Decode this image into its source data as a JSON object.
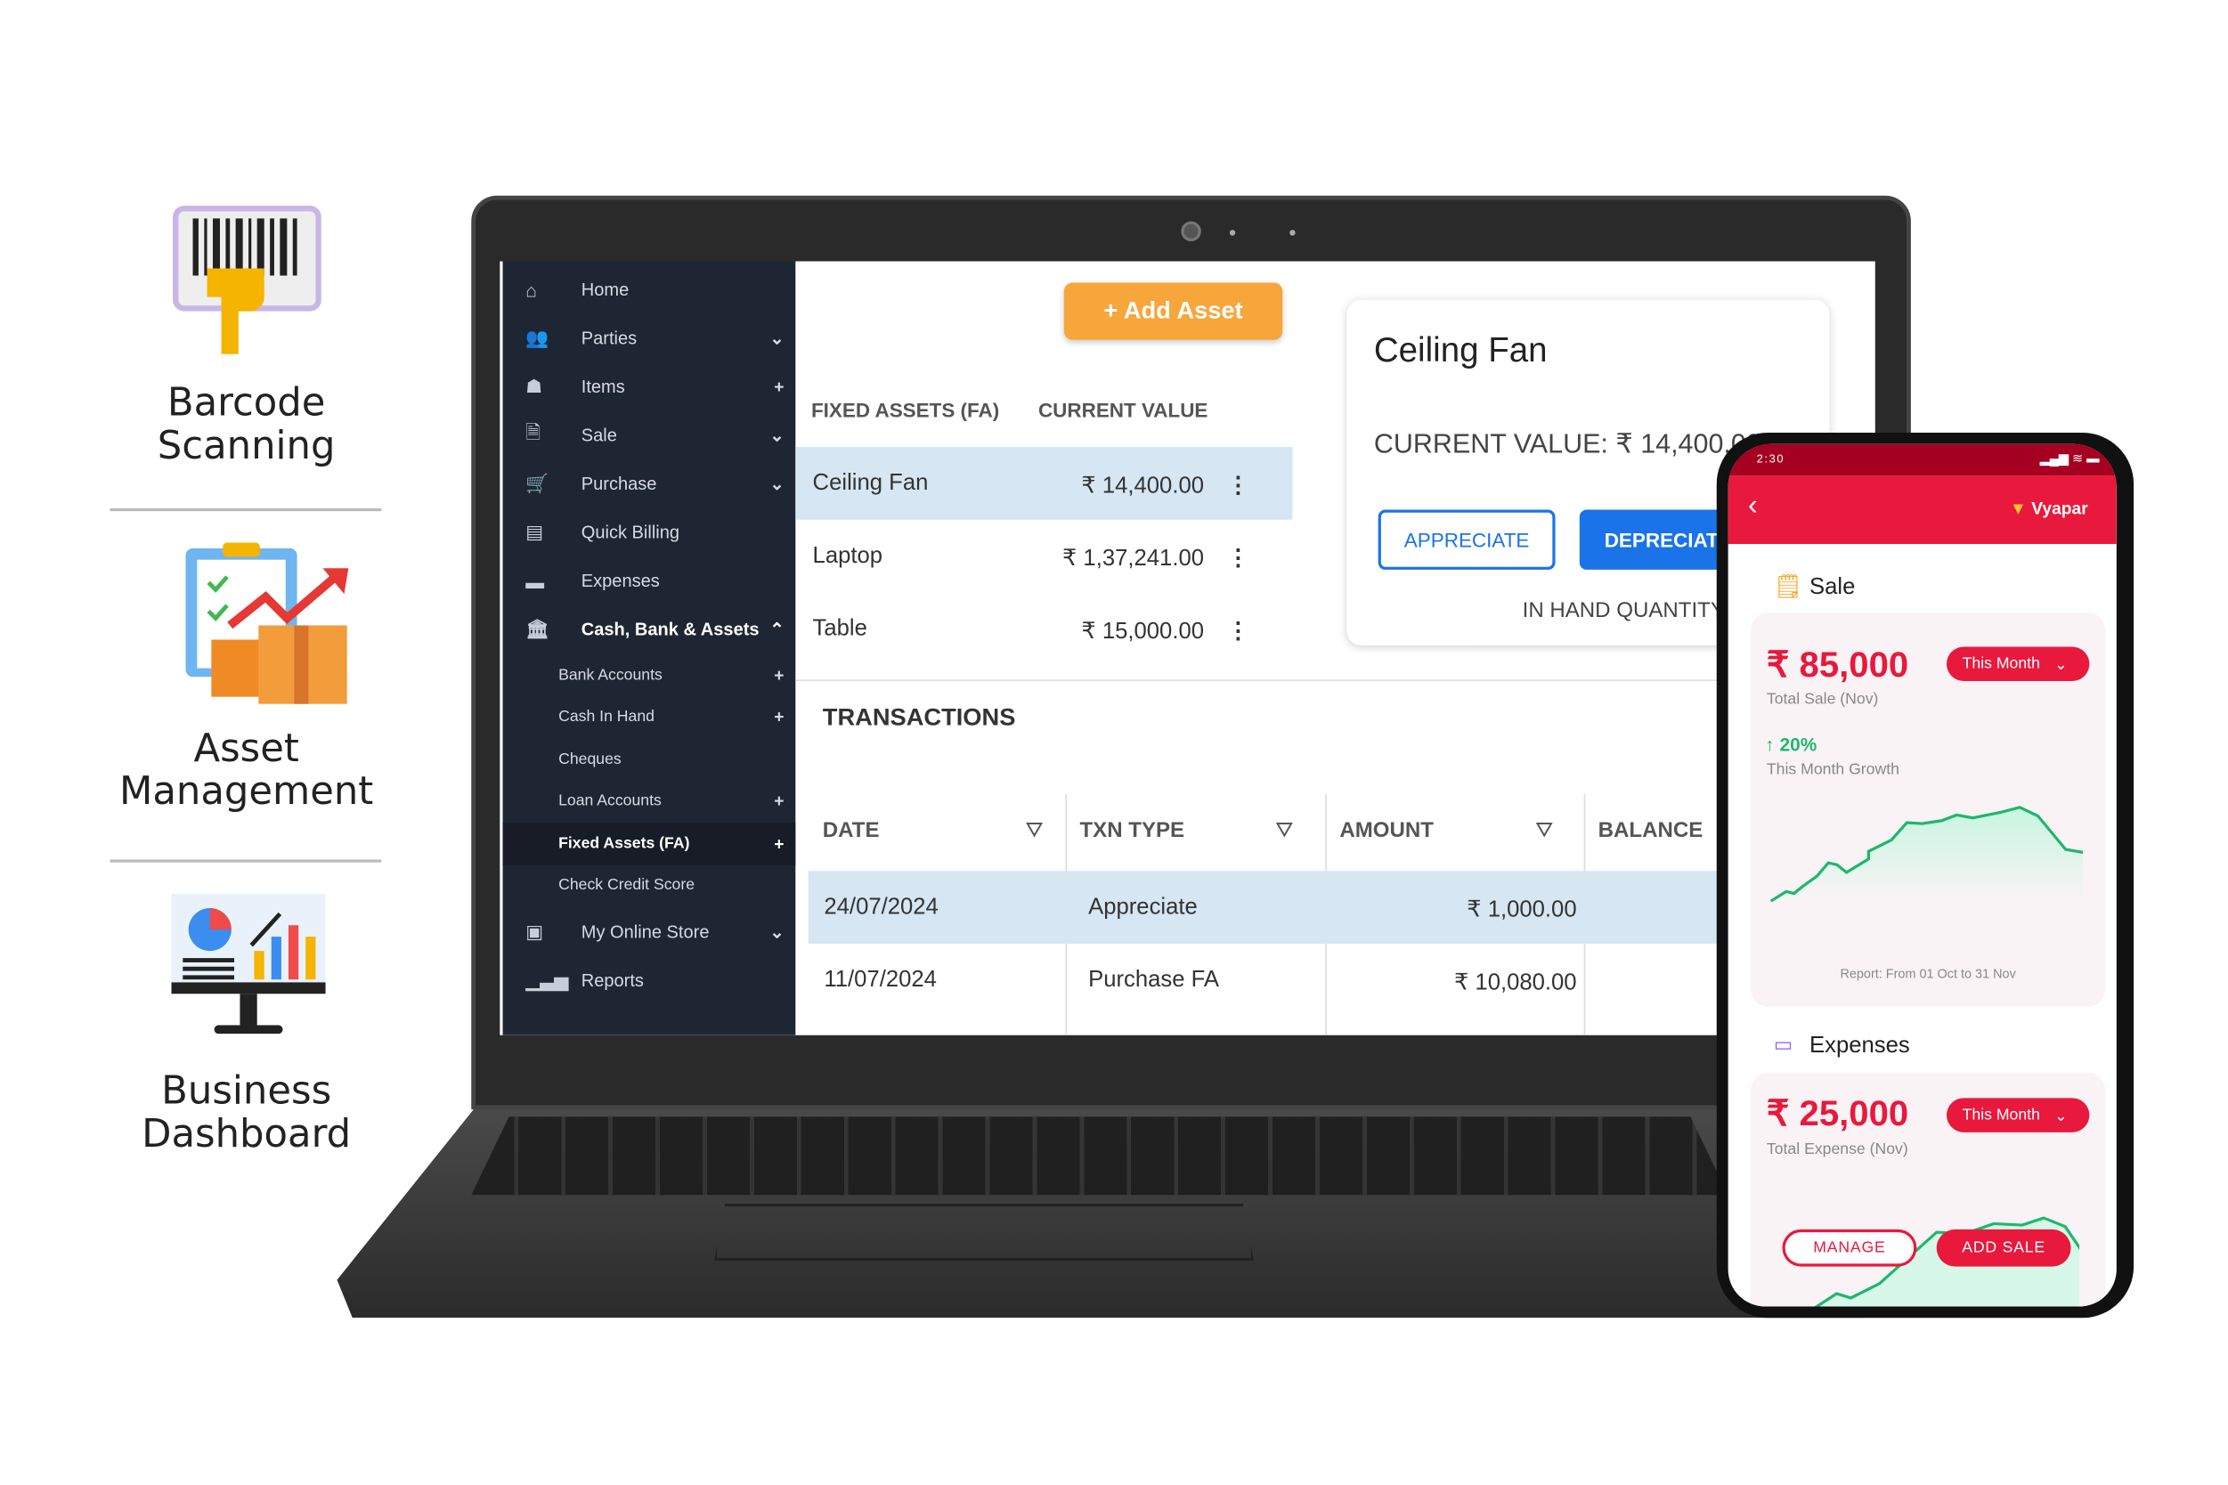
{
  "features": [
    {
      "label_line1": "Barcode",
      "label_line2": "Scanning",
      "icon": "barcode-scanner-icon"
    },
    {
      "label_line1": "Asset",
      "label_line2": "Management",
      "icon": "asset-boxes-icon"
    },
    {
      "label_line1": "Business",
      "label_line2": "Dashboard",
      "icon": "dashboard-monitor-icon"
    }
  ],
  "sidebar": {
    "items": [
      {
        "label": "Home",
        "icon": "home-icon"
      },
      {
        "label": "Parties",
        "icon": "users-icon",
        "trail": "chevron-down"
      },
      {
        "label": "Items",
        "icon": "items-icon",
        "trail": "plus"
      },
      {
        "label": "Sale",
        "icon": "sale-icon",
        "trail": "chevron-down"
      },
      {
        "label": "Purchase",
        "icon": "cart-icon",
        "trail": "chevron-down"
      },
      {
        "label": "Quick Billing",
        "icon": "billing-icon"
      },
      {
        "label": "Expenses",
        "icon": "wallet-icon"
      },
      {
        "label": "Cash, Bank & Assets",
        "icon": "bank-icon",
        "trail": "chevron-up"
      },
      {
        "label": "Bank Accounts",
        "trail": "plus"
      },
      {
        "label": "Cash In Hand",
        "trail": "plus"
      },
      {
        "label": "Cheques"
      },
      {
        "label": "Loan Accounts",
        "trail": "plus"
      },
      {
        "label": "Fixed Assets (FA)",
        "trail": "plus",
        "active": true
      },
      {
        "label": "Check Credit Score"
      },
      {
        "label": "My Online Store",
        "icon": "store-icon",
        "trail": "chevron-down"
      },
      {
        "label": "Reports",
        "icon": "reports-icon"
      }
    ]
  },
  "main": {
    "add_asset": "+ Add Asset",
    "col_assets": "FIXED ASSETS (FA)",
    "col_value": "CURRENT VALUE",
    "assets": [
      {
        "name": "Ceiling Fan",
        "value": "₹ 14,400.00"
      },
      {
        "name": "Laptop",
        "value": "₹ 1,37,241.00"
      },
      {
        "name": "Table",
        "value": "₹ 15,000.00"
      }
    ],
    "detail": {
      "title": "Ceiling Fan",
      "current_value": "CURRENT VALUE: ₹ 14,400.00",
      "appreciate": "APPRECIATE",
      "depreciate": "DEPRECIATE",
      "in_hand": "IN HAND QUANTITY"
    },
    "transactions_title": "TRANSACTIONS",
    "txn_cols": [
      "DATE",
      "TXN TYPE",
      "AMOUNT",
      "BALANCE"
    ],
    "txns": [
      {
        "date": "24/07/2024",
        "type": "Appreciate",
        "amount": "₹ 1,000.00"
      },
      {
        "date": "11/07/2024",
        "type": "Purchase FA",
        "amount": "₹ 10,080.00"
      }
    ]
  },
  "phone": {
    "time": "2:30",
    "brand": "Vyapar",
    "sale_title": "Sale",
    "sale_amount": "₹ 85,000",
    "period": "This Month",
    "sale_caption": "Total Sale (Nov)",
    "growth": "20%",
    "growth_caption": "This Month Growth",
    "report": "Report: From 01 Oct to 31 Nov",
    "exp_title": "Expenses",
    "exp_amount": "₹ 25,000",
    "exp_caption": "Total Expense (Nov)",
    "manage": "MANAGE",
    "add_sale": "ADD SALE"
  },
  "colors": {
    "sidebar": "#1f2633",
    "accent_orange": "#f7a63b",
    "selected_row": "#d6e6f2",
    "primary_blue": "#1a73e8",
    "vyapar_red": "#e8193c",
    "growth_green": "#1db86b"
  }
}
